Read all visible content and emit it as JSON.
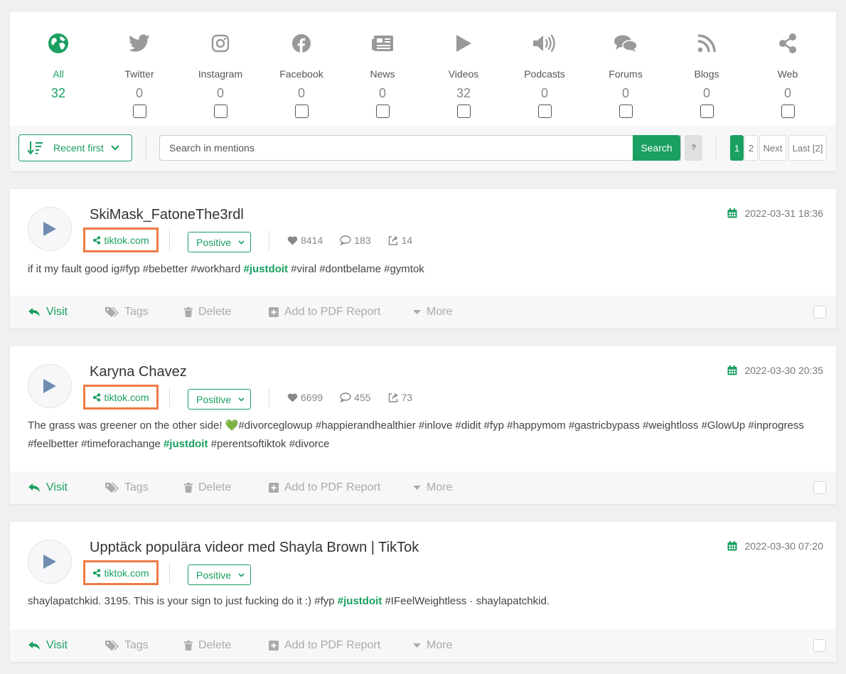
{
  "channels": [
    {
      "label": "All",
      "count": "32",
      "icon": "globe-icon",
      "active": true
    },
    {
      "label": "Twitter",
      "count": "0",
      "icon": "twitter-icon"
    },
    {
      "label": "Instagram",
      "count": "0",
      "icon": "instagram-icon"
    },
    {
      "label": "Facebook",
      "count": "0",
      "icon": "facebook-icon"
    },
    {
      "label": "News",
      "count": "0",
      "icon": "news-icon"
    },
    {
      "label": "Videos",
      "count": "32",
      "icon": "play-icon"
    },
    {
      "label": "Podcasts",
      "count": "0",
      "icon": "speaker-icon"
    },
    {
      "label": "Forums",
      "count": "0",
      "icon": "chat-bubbles-icon"
    },
    {
      "label": "Blogs",
      "count": "0",
      "icon": "rss-icon"
    },
    {
      "label": "Web",
      "count": "0",
      "icon": "share-icon"
    }
  ],
  "toolbar": {
    "sort_label": "Recent first",
    "search_placeholder": "Search in mentions",
    "search_label": "Search",
    "help_label": "?",
    "pages": [
      "1",
      "2"
    ],
    "next_label": "Next",
    "last_label": "Last [2]",
    "current_page": "1"
  },
  "mentions": [
    {
      "title": "SkiMask_FatoneThe3rdl",
      "date": "2022-03-31 18:36",
      "source": "tiktok.com",
      "sentiment": "Positive",
      "likes": "8414",
      "comments": "183",
      "shares": "14",
      "text_parts": [
        "if it my fault good ig#fyp #bebetter #workhard ",
        "#justdoit",
        " #viral #dontbelame #gymtok"
      ]
    },
    {
      "title": "Karyna Chavez",
      "date": "2022-03-30 20:35",
      "source": "tiktok.com",
      "sentiment": "Positive",
      "likes": "6699",
      "comments": "455",
      "shares": "73",
      "text_parts": [
        "The grass was greener on the other side! ",
        "💚",
        "#divorceglowup #happierandhealthier #inlove #didit #fyp #happymom #gastricbypass #weightloss #GlowUp #inprogress #feelbetter #timeforachange ",
        "#justdoit",
        " #perentsoftiktok #divorce"
      ]
    },
    {
      "title": "Upptäck populära videor med Shayla Brown | TikTok",
      "date": "2022-03-30 07:20",
      "source": "tiktok.com",
      "sentiment": "Positive",
      "text_parts": [
        "shaylapatchkid. 3195. This is your sign to just fucking do it :) #fyp ",
        "#justdoit",
        " #IFeelWeightless · shaylapatchkid."
      ]
    }
  ],
  "actions": {
    "visit": "Visit",
    "tags": "Tags",
    "delete": "Delete",
    "pdf": "Add to PDF Report",
    "more": "More"
  },
  "colors": {
    "accent": "#1aa060",
    "highlight_box": "#f07a45",
    "muted": "#aaaaaa"
  }
}
